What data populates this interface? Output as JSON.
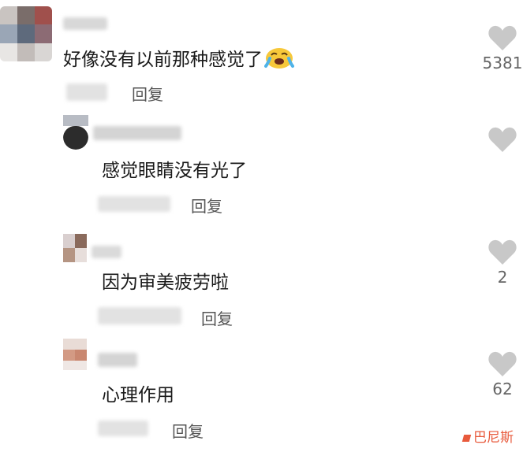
{
  "colors": {
    "like_icon": "#c8c8c8",
    "reply_text": "#555555",
    "watermark": "#e85a3c"
  },
  "comments": [
    {
      "text": "好像没有以前那种感觉了",
      "emoji": "crying-face-icon",
      "reply_label": "回复",
      "like_count": "5381"
    },
    {
      "text": "感觉眼睛没有光了",
      "reply_label": "回复",
      "like_count": ""
    },
    {
      "text": "因为审美疲劳啦",
      "reply_label": "回复",
      "like_count": "2"
    },
    {
      "text": "心理作用",
      "reply_label": "回复",
      "like_count": "62"
    }
  ],
  "watermark": {
    "text": "巴尼斯"
  }
}
